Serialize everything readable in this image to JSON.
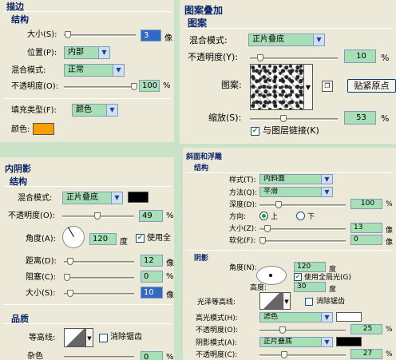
{
  "stroke": {
    "title": "描边",
    "section": "结构",
    "size_label": "大小(S):",
    "size_value": "3",
    "size_unit": "像",
    "position_label": "位置(P):",
    "position_value": "内部",
    "blend_label": "混合模式:",
    "blend_value": "正常",
    "opacity_label": "不透明度(O):",
    "opacity_value": "100",
    "opacity_unit": "%",
    "fill_type_label": "填充类型(F):",
    "fill_type_value": "颜色",
    "color_label": "颜色:",
    "color": "#f5a000"
  },
  "pattern": {
    "title": "图案叠加",
    "section": "图案",
    "blend_label": "混合模式:",
    "blend_value": "正片叠底",
    "opacity_label": "不透明度(Y):",
    "opacity_value": "10",
    "opacity_unit": "%",
    "pattern_label": "图案:",
    "snap_label": "贴紧原点",
    "scale_label": "缩放(S):",
    "scale_value": "53",
    "scale_unit": "%",
    "link_label": "与图层链接(K)",
    "link_checked": true
  },
  "inner_shadow": {
    "title": "内阴影",
    "section": "结构",
    "blend_label": "混合模式:",
    "blend_value": "正片叠底",
    "shadow_color": "#000000",
    "opacity_label": "不透明度(O):",
    "opacity_value": "49",
    "opacity_unit": "%",
    "angle_label": "角度(A):",
    "angle_value": "120",
    "angle_unit": "度",
    "global_light_label": "使用全",
    "distance_label": "距离(D):",
    "distance_value": "12",
    "distance_unit": "像",
    "choke_label": "阻塞(C):",
    "choke_value": "0",
    "choke_unit": "%",
    "size_label": "大小(S):",
    "size_value": "10",
    "size_unit": "像",
    "quality_section": "品质",
    "contour_label": "等高线:",
    "antialias_label": "消除锯齿",
    "noise_label": "杂色",
    "noise_value": "0",
    "noise_unit": "%"
  },
  "bevel": {
    "title": "斜面和浮雕",
    "section": "结构",
    "style_label": "样式(T):",
    "style_value": "内斜面",
    "technique_label": "方法(Q):",
    "technique_value": "平滑",
    "depth_label": "深度(D):",
    "depth_value": "100",
    "depth_unit": "%",
    "direction_label": "方向:",
    "dir_up": "上",
    "dir_down": "下",
    "size_label": "大小(Z):",
    "size_value": "13",
    "size_unit": "像",
    "soften_label": "软化(F):",
    "soften_value": "0",
    "soften_unit": "像",
    "shading_section": "阴影",
    "angle_label": "角度(N):",
    "angle_value": "120",
    "angle_unit": "度",
    "global_light_label": "使用全局光(G)",
    "altitude_label": "高度:",
    "altitude_value": "30",
    "altitude_unit": "度",
    "gloss_label": "光泽等高线:",
    "antialias_label": "消除锯齿",
    "highlight_label": "高光模式(H):",
    "highlight_value": "滤色",
    "highlight_color": "#ffffff",
    "hl_opacity_label": "不透明度(O):",
    "hl_opacity_value": "25",
    "hl_opacity_unit": "%",
    "shadow_mode_label": "阴影模式(A):",
    "shadow_mode_value": "正片叠底",
    "shadow_color": "#000000",
    "sh_opacity_label": "不透明度(C):",
    "sh_opacity_value": "27",
    "sh_opacity_unit": "%"
  }
}
